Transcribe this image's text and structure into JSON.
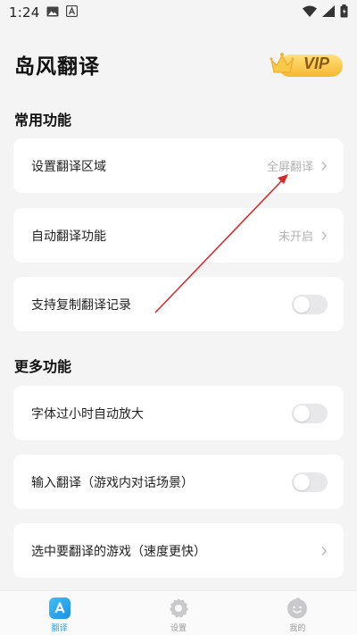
{
  "status_bar": {
    "time": "1:24",
    "icons": [
      "image-icon",
      "a-icon",
      "wifi-icon",
      "signal-icon",
      "battery-icon"
    ]
  },
  "header": {
    "title": "岛风翻译",
    "vip_label": "VIP"
  },
  "sections": [
    {
      "title": "常用功能",
      "items": [
        {
          "label": "设置翻译区域",
          "value": "全屏翻译",
          "control": "chevron"
        },
        {
          "label": "自动翻译功能",
          "value": "未开启",
          "control": "chevron"
        },
        {
          "label": "支持复制翻译记录",
          "control": "toggle",
          "on": false
        }
      ]
    },
    {
      "title": "更多功能",
      "items": [
        {
          "label": "字体过小时自动放大",
          "control": "toggle",
          "on": false
        },
        {
          "label": "输入翻译（游戏内对话场景）",
          "control": "toggle",
          "on": false
        },
        {
          "label": "选中要翻译的游戏（速度更快）",
          "control": "chevron"
        }
      ]
    }
  ],
  "tab_bar": {
    "tabs": [
      {
        "label": "翻译",
        "icon": "translate-icon",
        "active": true
      },
      {
        "label": "设置",
        "icon": "settings-gear-icon",
        "active": false
      },
      {
        "label": "我的",
        "icon": "profile-face-icon",
        "active": false
      }
    ]
  },
  "colors": {
    "background": "#f4f4f5",
    "card": "#ffffff",
    "accent_blue": "#2aa3ee",
    "vip_gold": "#f7c948",
    "vip_text": "#8a5a12",
    "annotation_arrow": "#d62b2b",
    "toggle_off": "#e8e8ea",
    "muted_text": "#b3b3b3"
  }
}
